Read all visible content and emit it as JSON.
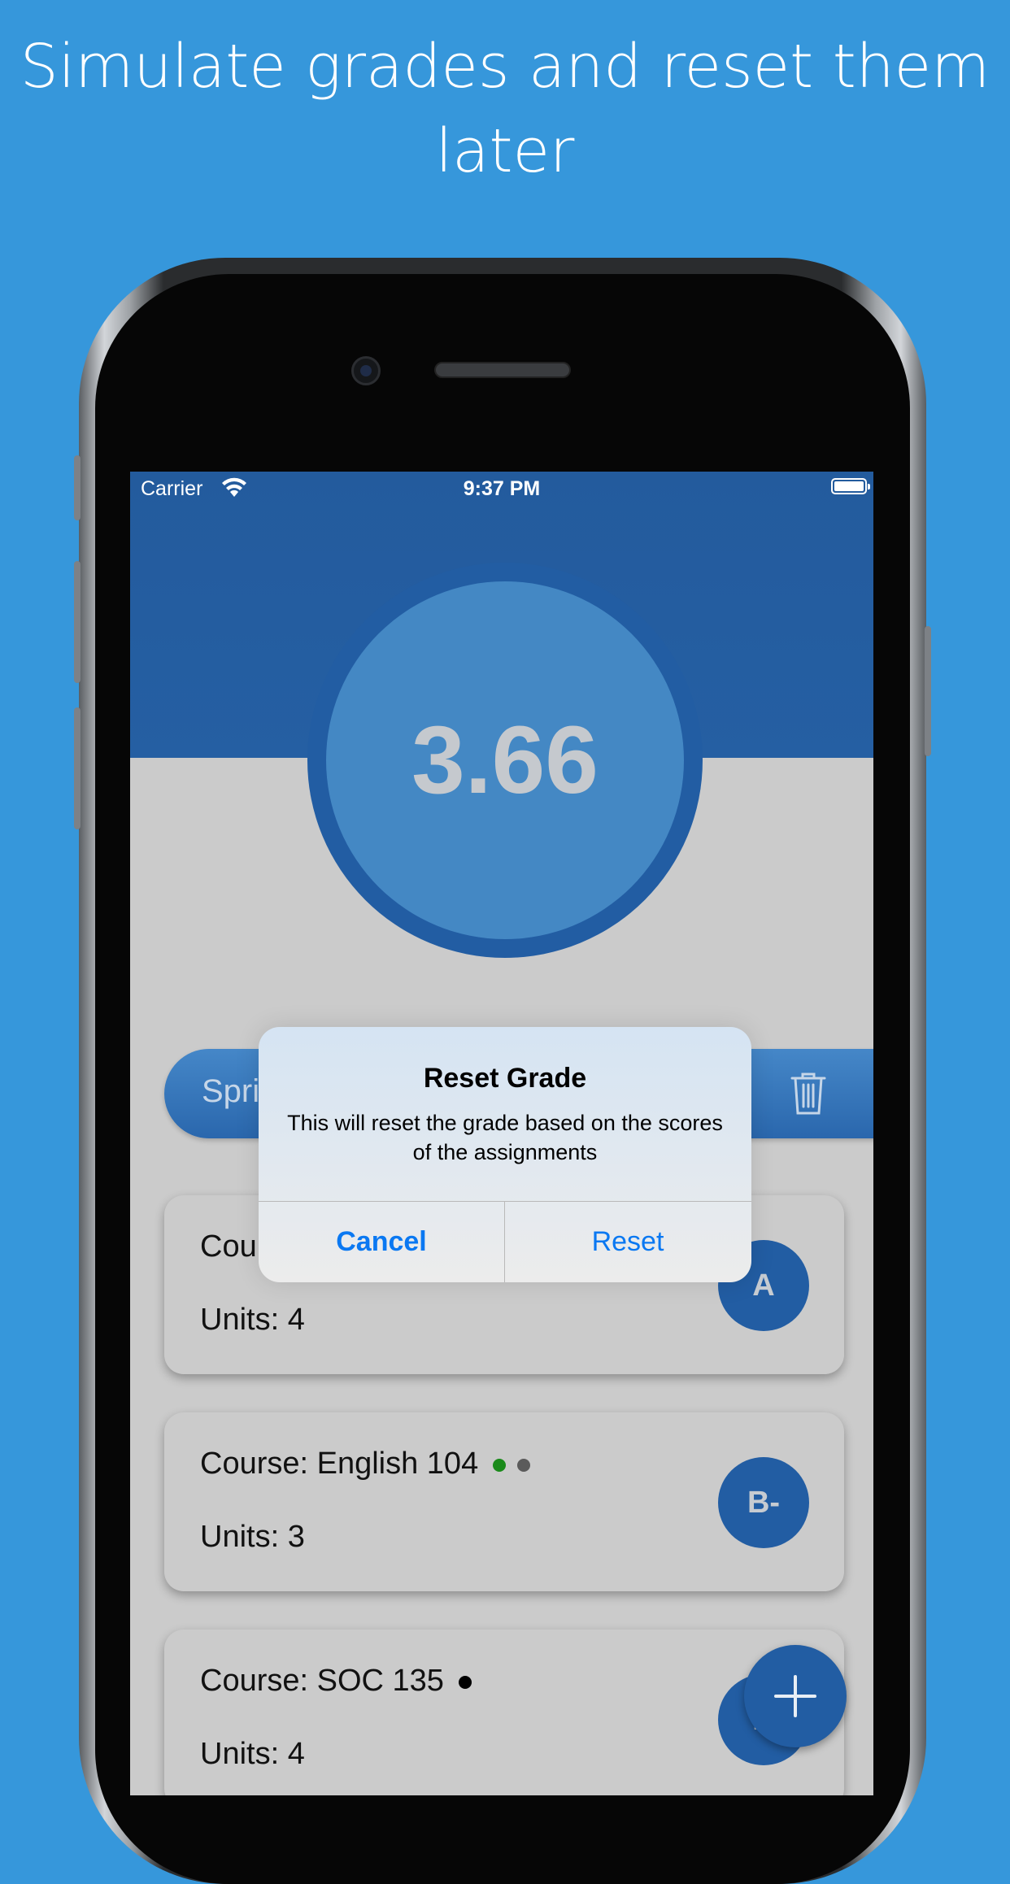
{
  "headline": "Simulate grades and reset them later",
  "status_bar": {
    "carrier": "Carrier",
    "time": "9:37 PM"
  },
  "gpa": "3.66",
  "semester": {
    "label": "Spring 2020"
  },
  "courses": [
    {
      "course": "Course: Math 101",
      "units": "Units: 4",
      "grade": "A"
    },
    {
      "course": "Course: English 104",
      "units": "Units: 3",
      "grade": "B-"
    },
    {
      "course": "Course: SOC 135",
      "units": "Units: 4",
      "grade": "B"
    }
  ],
  "alert": {
    "title": "Reset Grade",
    "message": "This will reset the grade based on the scores of the assignments",
    "cancel": "Cancel",
    "reset": "Reset"
  },
  "colors": {
    "background": "#3697db",
    "header": "#235b9d",
    "accent": "#0a78f2",
    "dot_green": "#1a8a1a",
    "dot_gray": "#5b5b5b",
    "dot_black": "#000000"
  },
  "icons": {
    "wifi": "wifi-icon",
    "battery": "battery-icon",
    "trash": "trash-icon",
    "add": "plus-icon"
  }
}
